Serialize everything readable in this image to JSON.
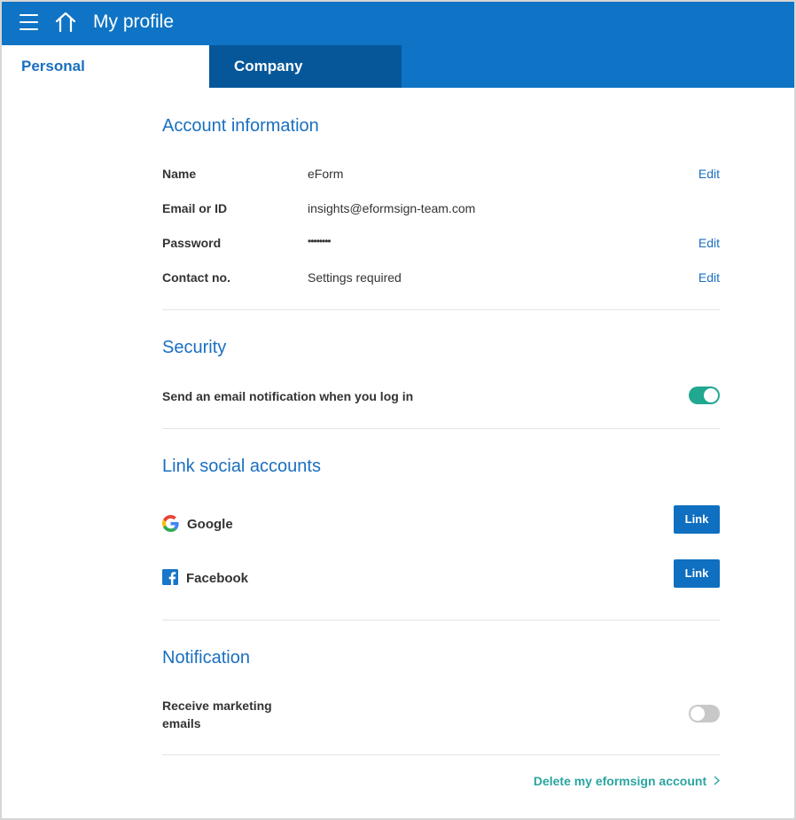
{
  "header": {
    "title": "My profile",
    "menu_icon": "hamburger-menu-icon",
    "home_icon": "home-icon"
  },
  "tabs": [
    {
      "label": "Personal",
      "active": true
    },
    {
      "label": "Company",
      "active": false
    }
  ],
  "account": {
    "title": "Account information",
    "rows": [
      {
        "label": "Name",
        "value": "eForm",
        "action": "Edit"
      },
      {
        "label": "Email or ID",
        "value": "insights@eformsign-team.com",
        "action": ""
      },
      {
        "label": "Password",
        "value": "••••••••",
        "action": "Edit"
      },
      {
        "label": "Contact no.",
        "value": "Settings required",
        "action": "Edit"
      }
    ]
  },
  "security": {
    "title": "Security",
    "login_notification_label": "Send an email notification when you log in",
    "login_notification_on": true
  },
  "social": {
    "title": "Link social accounts",
    "items": [
      {
        "name": "Google",
        "button": "Link",
        "icon": "google-icon"
      },
      {
        "name": "Facebook",
        "button": "Link",
        "icon": "facebook-icon"
      }
    ]
  },
  "notification": {
    "title": "Notification",
    "marketing_label_line1": "Receive marketing",
    "marketing_label_line2": "emails",
    "marketing_on": false
  },
  "footer": {
    "delete_label": "Delete my eformsign account"
  },
  "colors": {
    "primary": "#0f74c5",
    "tab_dark": "#06579a",
    "heading": "#1a6fc0",
    "toggle_on": "#21a890",
    "delete_link": "#2aa5a0"
  }
}
